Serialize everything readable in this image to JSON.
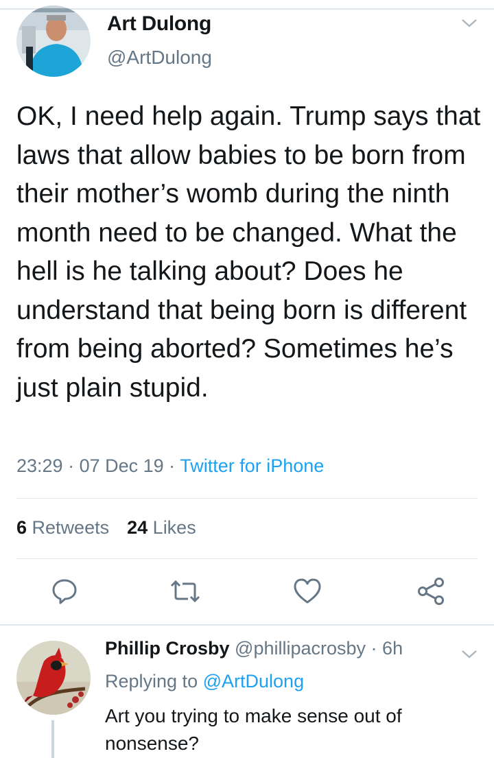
{
  "tweet": {
    "author_name": "Art Dulong",
    "author_handle": "@ArtDulong",
    "text": "OK, I need help again. Trump says that laws that allow babies to be born from their mother’s womb during the ninth month need to be changed. What the hell is he talking about? Does he understand that being born is different from being aborted? Sometimes he’s just plain stupid.",
    "time": "23:29",
    "date": "07 Dec 19",
    "source": "Twitter for iPhone",
    "separator": " · ",
    "retweets_count": "6",
    "retweets_label": "Retweets",
    "likes_count": "24",
    "likes_label": "Likes"
  },
  "actions": {
    "icons": [
      "reply-icon",
      "retweet-icon",
      "like-icon",
      "share-icon"
    ]
  },
  "reply": {
    "author_name": "Phillip Crosby",
    "author_handle": "@phillipacrosby",
    "age": "6h",
    "replying_prefix": "Replying to",
    "replying_to": "@ArtDulong",
    "text": "Art you trying to make sense out of nonsense?"
  },
  "colors": {
    "text": "#14171a",
    "secondary": "#657786",
    "link": "#1da1f2",
    "divider": "#e1e8ed"
  }
}
